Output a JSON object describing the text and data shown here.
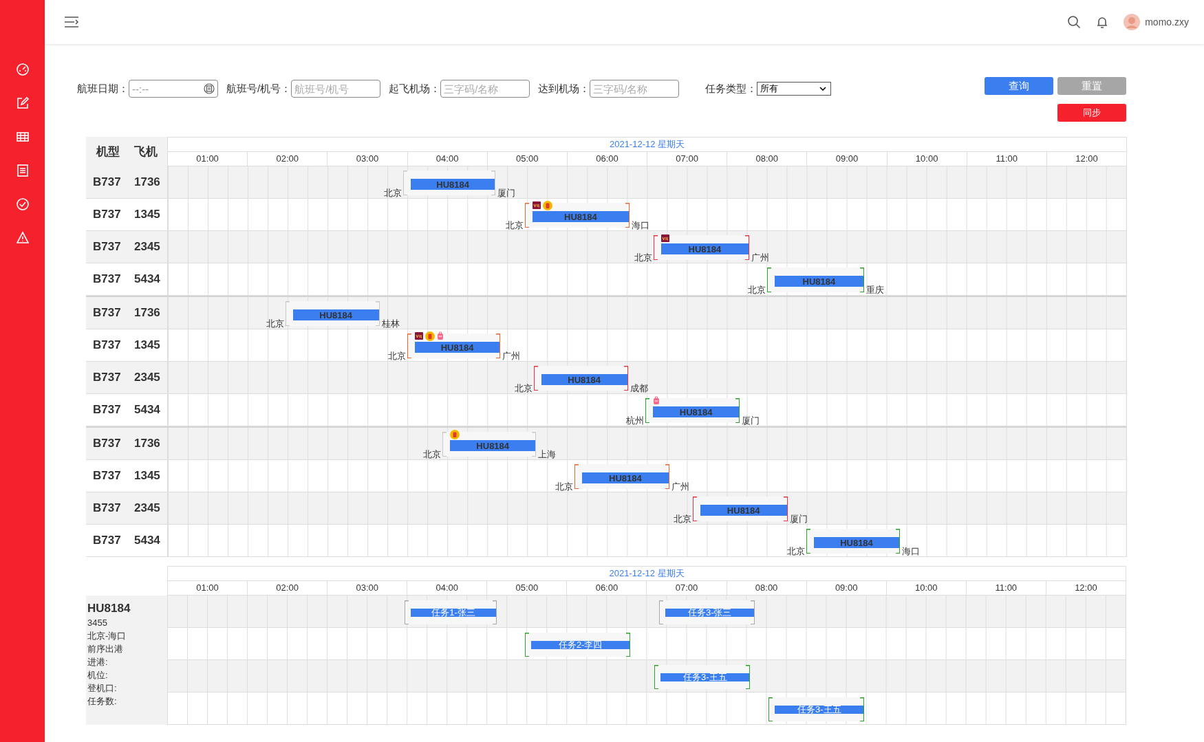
{
  "header": {
    "user": "momo.zxy"
  },
  "filters": [
    {
      "kind": "date",
      "label": "航班日期：",
      "value": "--:--"
    },
    {
      "kind": "text",
      "label": "航班号/机号：",
      "placeholder": "航班号/机号"
    },
    {
      "kind": "text",
      "label": "起飞机场：",
      "placeholder": "三字码/名称"
    },
    {
      "kind": "text",
      "label": "达到机场：",
      "placeholder": "三字码/名称"
    },
    {
      "kind": "select",
      "label": "任务类型：",
      "value": "所有"
    }
  ],
  "buttons": [
    {
      "kind": "primary",
      "label": "查询"
    },
    {
      "kind": "secondary",
      "label": "重置"
    },
    {
      "kind": "danger",
      "label": "同步"
    }
  ],
  "flight_chart": {
    "date": "2021-12-12 星期天",
    "columns": [
      "机型",
      "飞机"
    ],
    "hours": [
      "01:00",
      "02:00",
      "03:00",
      "04:00",
      "05:00",
      "06:00",
      "07:00",
      "08:00",
      "09:00",
      "10:00",
      "11:00",
      "12:00"
    ],
    "groups": [
      {
        "rows": [
          {
            "type": "B737",
            "aircraft": "1736",
            "flight": {
              "code": "HU8184",
              "from": "北京",
              "to": "厦门",
              "color": "#c8c8c8"
            }
          },
          {
            "type": "B737",
            "aircraft": "1345",
            "flight": {
              "code": "HU8184",
              "from": "北京",
              "to": "海口",
              "color": "#f0642a",
              "icons": [
                {
                  "kind": "vip"
                },
                {
                  "kind": "suitcase"
                }
              ]
            }
          },
          {
            "type": "B737",
            "aircraft": "2345",
            "flight": {
              "code": "HU8184",
              "from": "北京",
              "to": "广州",
              "color": "#e8323c",
              "icons": [
                {
                  "kind": "vip"
                }
              ]
            }
          },
          {
            "type": "B737",
            "aircraft": "5434",
            "flight": {
              "code": "HU8184",
              "from": "北京",
              "to": "重庆",
              "color": "#2aa52a"
            }
          }
        ]
      },
      {
        "rows": [
          {
            "type": "B737",
            "aircraft": "1736",
            "flight": {
              "code": "HU8184",
              "from": "北京",
              "to": "桂林",
              "color": "#c8c8c8"
            }
          },
          {
            "type": "B737",
            "aircraft": "1345",
            "flight": {
              "code": "HU8184",
              "from": "北京",
              "to": "广州",
              "color": "#f0642a",
              "icons": [
                {
                  "kind": "vip"
                },
                {
                  "kind": "suitcase"
                },
                {
                  "kind": "luggage"
                }
              ]
            }
          },
          {
            "type": "B737",
            "aircraft": "2345",
            "flight": {
              "code": "HU8184",
              "from": "北京",
              "to": "成都",
              "color": "#e8323c"
            }
          },
          {
            "type": "B737",
            "aircraft": "5434",
            "flight": {
              "code": "HU8184",
              "from": "杭州",
              "to": "厦门",
              "color": "#2aa52a",
              "icons": [
                {
                  "kind": "luggage"
                }
              ]
            }
          }
        ]
      },
      {
        "rows": [
          {
            "type": "B737",
            "aircraft": "1736",
            "flight": {
              "code": "HU8184",
              "from": "北京",
              "to": "上海",
              "color": "#c8c8c8",
              "icons": [
                {
                  "kind": "suitcase"
                }
              ]
            }
          },
          {
            "type": "B737",
            "aircraft": "1345",
            "flight": {
              "code": "HU8184",
              "from": "北京",
              "to": "广州",
              "color": "#f0642a"
            }
          },
          {
            "type": "B737",
            "aircraft": "2345",
            "flight": {
              "code": "HU8184",
              "from": "北京",
              "to": "厦门",
              "color": "#e8323c"
            }
          },
          {
            "type": "B737",
            "aircraft": "5434",
            "flight": {
              "code": "HU8184",
              "from": "北京",
              "to": "海口",
              "color": "#2aa52a"
            }
          }
        ]
      }
    ]
  },
  "task_chart": {
    "date": "2021-12-12 星期天",
    "hours": [
      "01:00",
      "02:00",
      "03:00",
      "04:00",
      "05:00",
      "06:00",
      "07:00",
      "08:00",
      "09:00",
      "10:00",
      "11:00",
      "12:00"
    ],
    "info": {
      "flight": "HU8184",
      "aircraft": "3455",
      "route": "北京-海口",
      "lines": [
        "前序出港",
        "进港:",
        "机位:",
        "登机口:",
        "任务数:"
      ]
    },
    "rows": [
      {
        "tasks": [
          {
            "label": "任务1-张三",
            "color": "#aaaaaa"
          },
          {
            "label": "任务3-张三",
            "color": "#aaaaaa"
          }
        ]
      },
      {
        "tasks": [
          {
            "label": "任务2-李四",
            "color": "#2aa52a"
          }
        ]
      },
      {
        "tasks": [
          {
            "label": "任务3-王五",
            "color": "#2aa52a"
          }
        ]
      },
      {
        "tasks": [
          {
            "label": "任务3-王五",
            "color": "#2aa52a"
          }
        ]
      }
    ]
  }
}
